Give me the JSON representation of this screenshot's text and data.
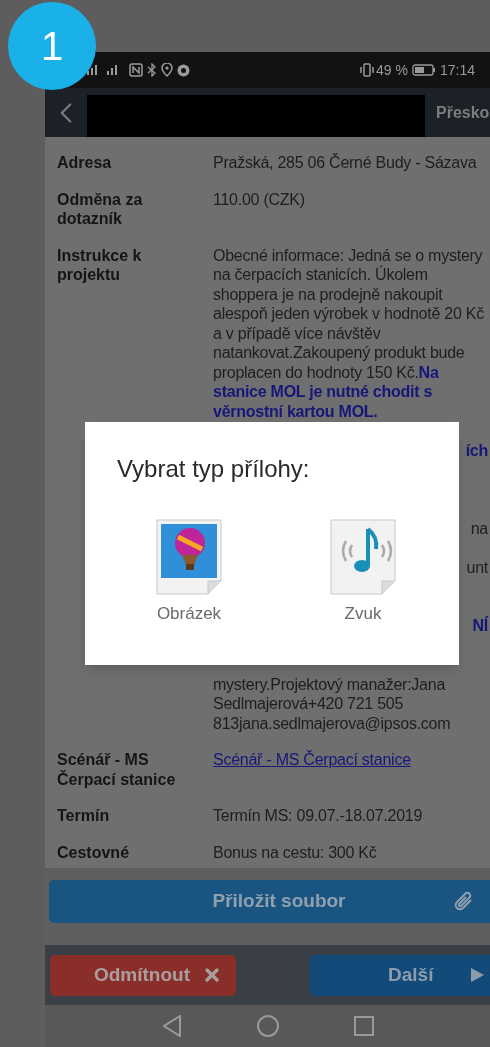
{
  "badge": "1",
  "status_bar": {
    "battery": "49 %",
    "time": "17:14"
  },
  "app_bar": {
    "action": "Přesko"
  },
  "details": [
    {
      "kind": "text",
      "label": "Adresa",
      "value": "Pražská, 285 06 Černé Budy - Sázava"
    },
    {
      "kind": "text",
      "label": "Odměna za dotazník",
      "value": "110.00 (CZK)"
    },
    {
      "kind": "instructions",
      "label": "Instrukce k projektu",
      "value": "Obecné informace: Jedná se o mystery na čerpacích stanicích. Úkolem shoppera je na prodejně nakoupit alespoň jeden výrobek v hodnotě 20 Kč a v případě více návštěv natankovat.Zakoupený produkt bude proplacen do hodnoty 150 Kč.**Na stanice MOL je nutné chodit s věrnostní kartou MOL.**",
      "fragments": [
        {
          "text": "ích",
          "emphasis": true
        },
        {
          "text": "na",
          "emphasis": false
        },
        {
          "text": "unt",
          "emphasis": false
        },
        {
          "text": "NÍ",
          "emphasis": true
        }
      ],
      "tail": "mystery.Projektový manažer:Jana Sedlmajerová+420 721 505 813jana.sedlmajerova@ipsos.com"
    },
    {
      "kind": "link",
      "label": "Scénář - MS Čerpací stanice",
      "value": "Scénář - MS Čerpací stanice"
    },
    {
      "kind": "text",
      "label": "Termín",
      "value": "Termín MS: 09.07.-18.07.2019"
    },
    {
      "kind": "text",
      "label": "Cestovné",
      "value": "Bonus na cestu: 300 Kč"
    }
  ],
  "attach_button": "Přiložit soubor",
  "reject_button": "Odmítnout",
  "next_button": "Další",
  "dialog": {
    "title": "Vybrat typ přílohy:",
    "options": [
      {
        "kind": "image",
        "label": "Obrázek"
      },
      {
        "kind": "sound",
        "label": "Zvuk"
      }
    ]
  }
}
